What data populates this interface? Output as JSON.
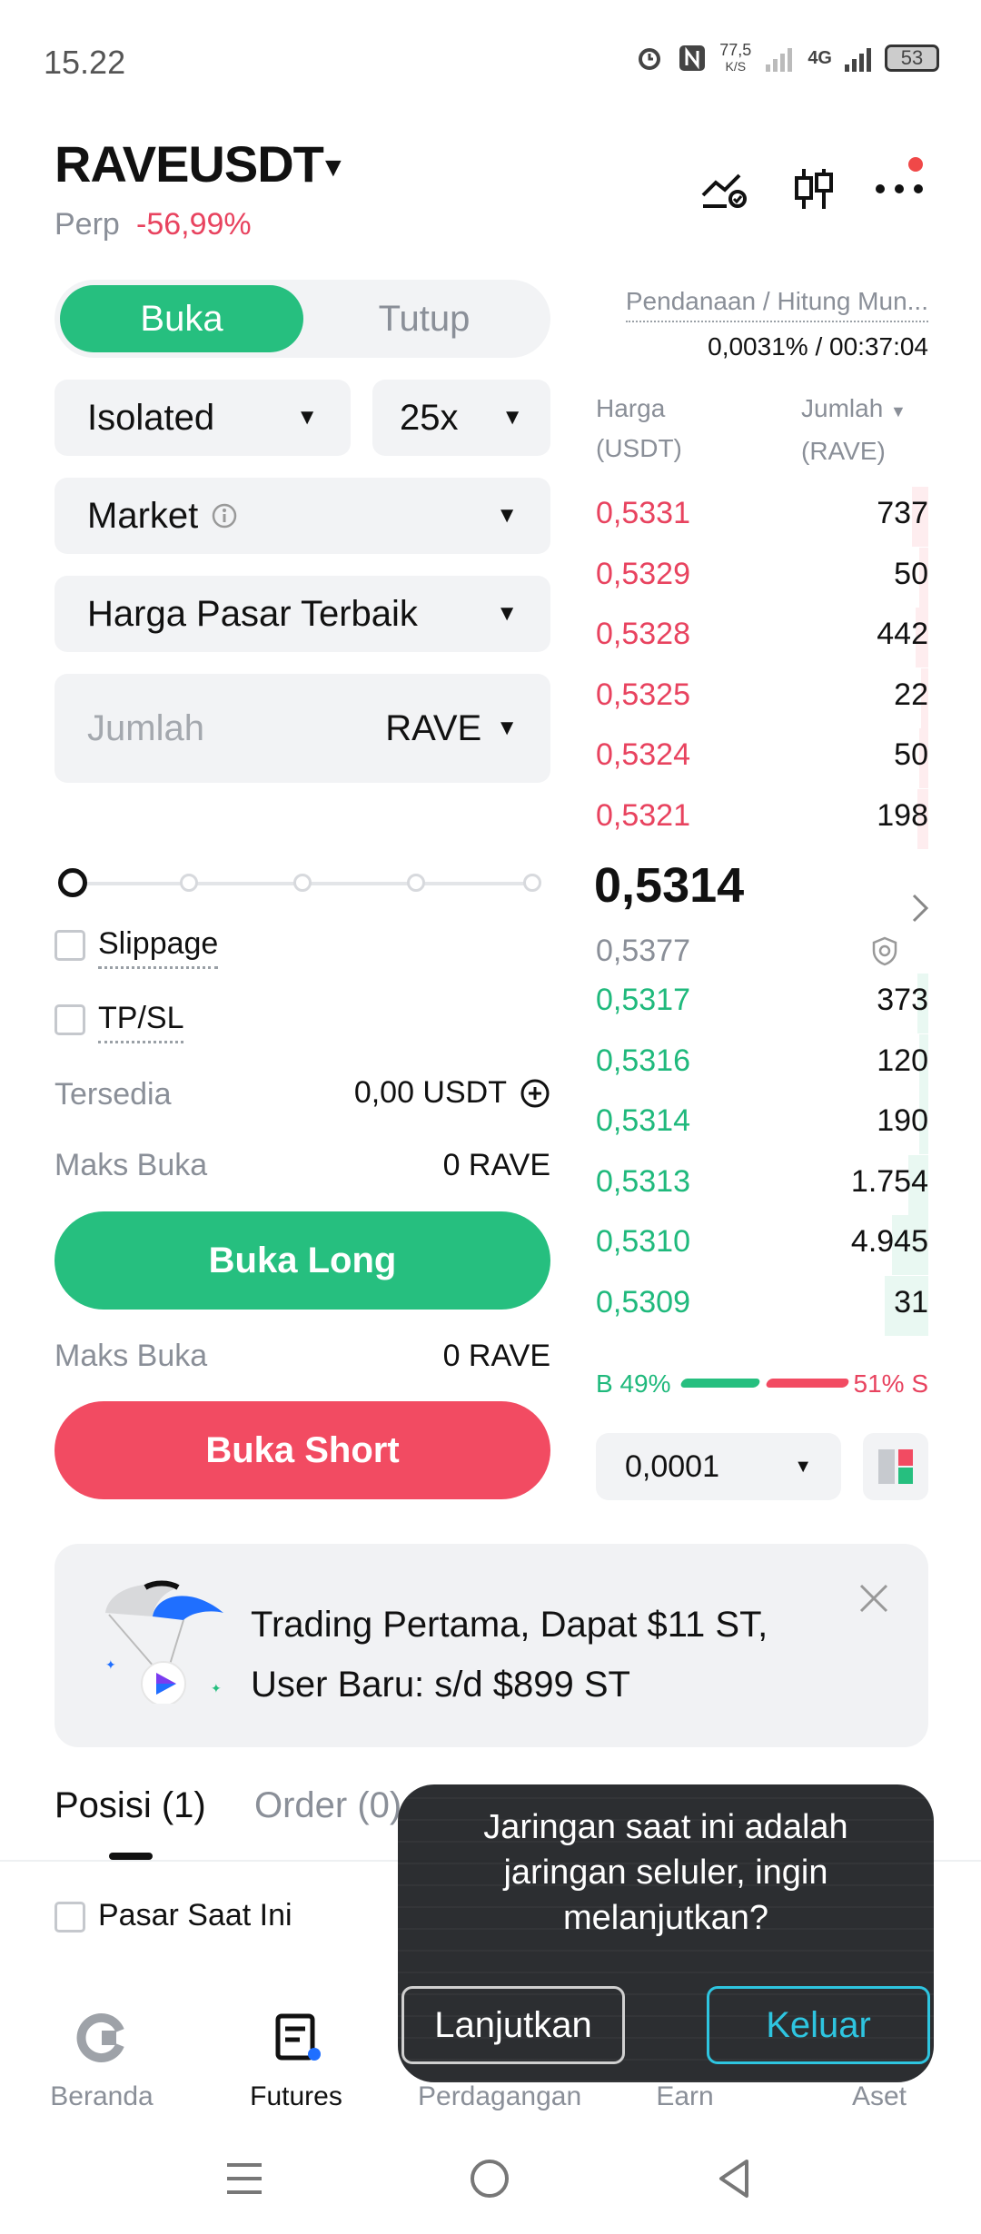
{
  "status_bar": {
    "time": "15.22",
    "net_speed_value": "77,5",
    "net_speed_unit": "K/S",
    "network": "4G",
    "battery": "53"
  },
  "header": {
    "pair": "RAVEUSDT",
    "contract_type": "Perp",
    "change": "-56,99%"
  },
  "tabs": {
    "open": "Buka",
    "close": "Tutup"
  },
  "form": {
    "margin_mode": "Isolated",
    "leverage": "25x",
    "order_type": "Market",
    "price_mode": "Harga Pasar Terbaik",
    "amount_placeholder": "Jumlah",
    "amount_unit": "RAVE",
    "slippage_label": "Slippage",
    "tpsl_label": "TP/SL",
    "available_label": "Tersedia",
    "available_value": "0,00 USDT",
    "max_open_label": "Maks Buka",
    "max_open_long": "0 RAVE",
    "long_button": "Buka Long",
    "max_open_label_2": "Maks Buka",
    "max_open_short": "0 RAVE",
    "short_button": "Buka Short",
    "slider_level_percent": 0
  },
  "funding": {
    "label": "Pendanaan / Hitung Mun...",
    "value": "0,0031% / 00:37:04"
  },
  "orderbook": {
    "price_header_1": "Harga",
    "price_header_2": "(USDT)",
    "qty_header_1": "Jumlah",
    "qty_header_2": "(RAVE)",
    "asks": [
      {
        "price": "0,5331",
        "qty": "737"
      },
      {
        "price": "0,5329",
        "qty": "50"
      },
      {
        "price": "0,5328",
        "qty": "442"
      },
      {
        "price": "0,5325",
        "qty": "22"
      },
      {
        "price": "0,5324",
        "qty": "50"
      },
      {
        "price": "0,5321",
        "qty": "198"
      }
    ],
    "last_price": "0,5314",
    "mark_price": "0,5377",
    "bids": [
      {
        "price": "0,5317",
        "qty": "373"
      },
      {
        "price": "0,5316",
        "qty": "120"
      },
      {
        "price": "0,5314",
        "qty": "190"
      },
      {
        "price": "0,5313",
        "qty": "1.754"
      },
      {
        "price": "0,5310",
        "qty": "4.945"
      },
      {
        "price": "0,5309",
        "qty": "31"
      }
    ],
    "buy_ratio": "B 49%",
    "sell_ratio": "51% S",
    "buy_percent": 49,
    "precision": "0,0001"
  },
  "banner": {
    "line1": "Trading Pertama, Dapat $11 ST,",
    "line2": "User Baru: s/d $899 ST"
  },
  "positions": {
    "tab_positions": "Posisi (1)",
    "tab_orders": "Order (0)",
    "current_market_label": "Pasar Saat Ini"
  },
  "dialog": {
    "message_1": "Jaringan saat ini adalah",
    "message_2": "jaringan seluler, ingin",
    "message_3": "melanjutkan?",
    "continue_button": "Lanjutkan",
    "exit_button": "Keluar"
  },
  "bottom_nav": [
    {
      "label": "Beranda"
    },
    {
      "label": "Futures"
    },
    {
      "label": "Perdagangan"
    },
    {
      "label": "Earn"
    },
    {
      "label": "Aset"
    }
  ],
  "colors": {
    "green": "#26bf7f",
    "red": "#f24b62",
    "accent_blue": "#1f6fff"
  }
}
